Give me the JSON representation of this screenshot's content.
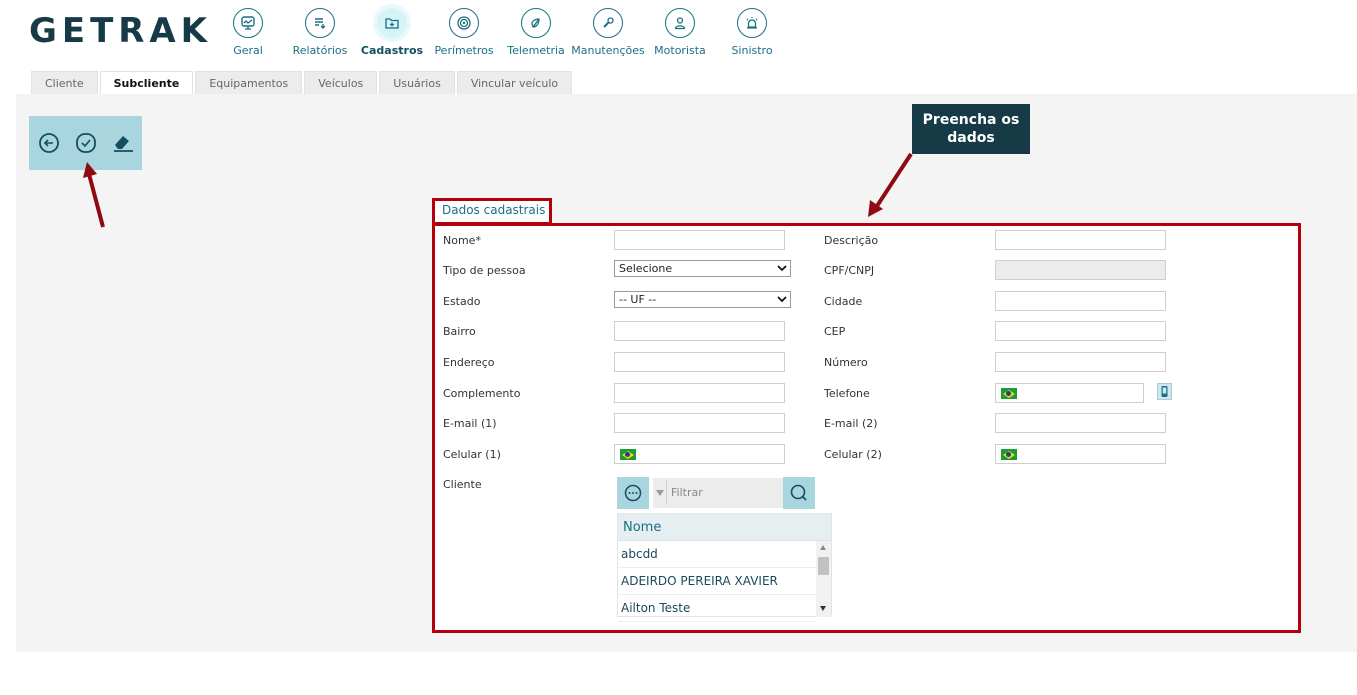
{
  "brand": {
    "logo_text": "GETRAK",
    "color": "#163b47"
  },
  "nav": {
    "items": [
      {
        "label": "Geral",
        "icon": "chart-monitor-icon"
      },
      {
        "label": "Relatórios",
        "icon": "report-icon"
      },
      {
        "label": "Cadastros",
        "icon": "folder-add-icon",
        "active": true
      },
      {
        "label": "Perímetros",
        "icon": "target-icon"
      },
      {
        "label": "Telemetria",
        "icon": "gauge-icon"
      },
      {
        "label": "Manutenções",
        "icon": "wrench-icon"
      },
      {
        "label": "Motorista",
        "icon": "driver-icon"
      },
      {
        "label": "Sinistro",
        "icon": "alarm-icon"
      }
    ]
  },
  "tabs": [
    {
      "label": "Cliente"
    },
    {
      "label": "Subcliente",
      "active": true
    },
    {
      "label": "Equipamentos"
    },
    {
      "label": "Veículos"
    },
    {
      "label": "Usuários"
    },
    {
      "label": "Vincular veículo"
    }
  ],
  "toolbar": {
    "buttons": [
      "back-icon",
      "confirm-icon",
      "eraser-icon"
    ]
  },
  "annotation": {
    "callout_text": "Preencha os dados",
    "highlight_color": "#b3000c"
  },
  "form": {
    "section_title": "Dados cadastrais",
    "left": {
      "nome": {
        "label": "Nome*",
        "value": ""
      },
      "tipo_pessoa": {
        "label": "Tipo de pessoa",
        "selected": "Selecione"
      },
      "estado": {
        "label": "Estado",
        "selected": "-- UF --"
      },
      "bairro": {
        "label": "Bairro",
        "value": ""
      },
      "endereco": {
        "label": "Endereço",
        "value": ""
      },
      "complemento": {
        "label": "Complemento",
        "value": ""
      },
      "email1": {
        "label": "E-mail (1)",
        "value": ""
      },
      "celular1": {
        "label": "Celular (1)",
        "value": ""
      },
      "cliente": {
        "label": "Cliente"
      }
    },
    "right": {
      "descricao": {
        "label": "Descrição",
        "value": ""
      },
      "cpf_cnpj": {
        "label": "CPF/CNPJ",
        "value": ""
      },
      "cidade": {
        "label": "Cidade",
        "value": ""
      },
      "cep": {
        "label": "CEP",
        "value": ""
      },
      "numero": {
        "label": "Número",
        "value": ""
      },
      "telefone": {
        "label": "Telefone",
        "value": ""
      },
      "email2": {
        "label": "E-mail (2)",
        "value": ""
      },
      "celular2": {
        "label": "Celular (2)",
        "value": ""
      }
    }
  },
  "client_grid": {
    "filter_placeholder": "Filtrar",
    "column": "Nome",
    "rows": [
      "abcdd",
      "ADEIRDO PEREIRA XAVIER",
      "Ailton Teste"
    ]
  }
}
